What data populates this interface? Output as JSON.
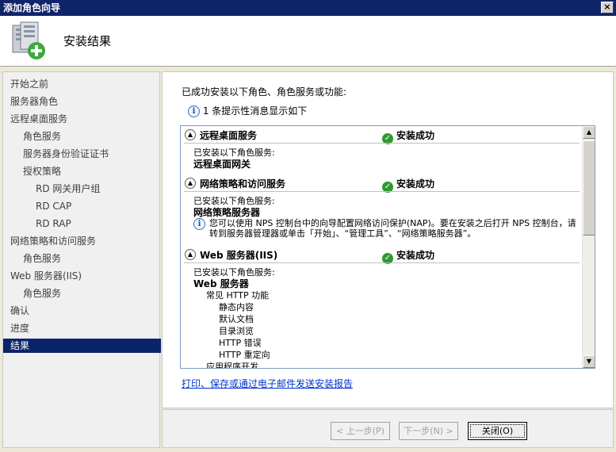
{
  "window": {
    "title": "添加角色向导",
    "close": "×"
  },
  "header": {
    "title": "安装结果"
  },
  "sidebar": {
    "items": [
      {
        "label": "开始之前"
      },
      {
        "label": "服务器角色"
      },
      {
        "label": "远程桌面服务"
      },
      {
        "label": "角色服务"
      },
      {
        "label": "服务器身份验证证书"
      },
      {
        "label": "授权策略"
      },
      {
        "label": "RD 网关用户组"
      },
      {
        "label": "RD CAP"
      },
      {
        "label": "RD RAP"
      },
      {
        "label": "网络策略和访问服务"
      },
      {
        "label": "角色服务"
      },
      {
        "label": "Web 服务器(IIS)"
      },
      {
        "label": "角色服务"
      },
      {
        "label": "确认"
      },
      {
        "label": "进度"
      },
      {
        "label": "结果"
      }
    ]
  },
  "main": {
    "intro": "已成功安装以下角色、角色服务或功能:",
    "info_count": "1 条提示性消息显示如下",
    "sections": [
      {
        "name": "远程桌面服务",
        "status": "安装成功",
        "installed_label": "已安装以下角色服务:",
        "service": "远程桌面网关"
      },
      {
        "name": "网络策略和访问服务",
        "status": "安装成功",
        "installed_label": "已安装以下角色服务:",
        "service": "网络策略服务器",
        "note": "您可以使用 NPS 控制台中的向导配置网络访问保护(NAP)。要在安装之后打开 NPS 控制台，请转到服务器管理器或单击「开始」、“管理工具”、“网络策略服务器”。"
      },
      {
        "name": "Web 服务器(IIS)",
        "status": "安装成功",
        "installed_label": "已安装以下角色服务:",
        "service": "Web 服务器",
        "sub_group": "常见 HTTP 功能",
        "features": [
          "静态内容",
          "默认文档",
          "目录浏览",
          "HTTP 错误",
          "HTTP 重定向"
        ],
        "next_group": "应用程序开发"
      }
    ],
    "report_link": "打印、保存或通过电子邮件发送安装报告"
  },
  "buttons": {
    "prev": "< 上一步(P)",
    "next": "下一步(N) >",
    "close": "关闭(O)"
  },
  "colors": {
    "titlebar": "#10246a",
    "selected": "#0a246a",
    "link": "#0033cc",
    "success": "#2f9a2f"
  }
}
